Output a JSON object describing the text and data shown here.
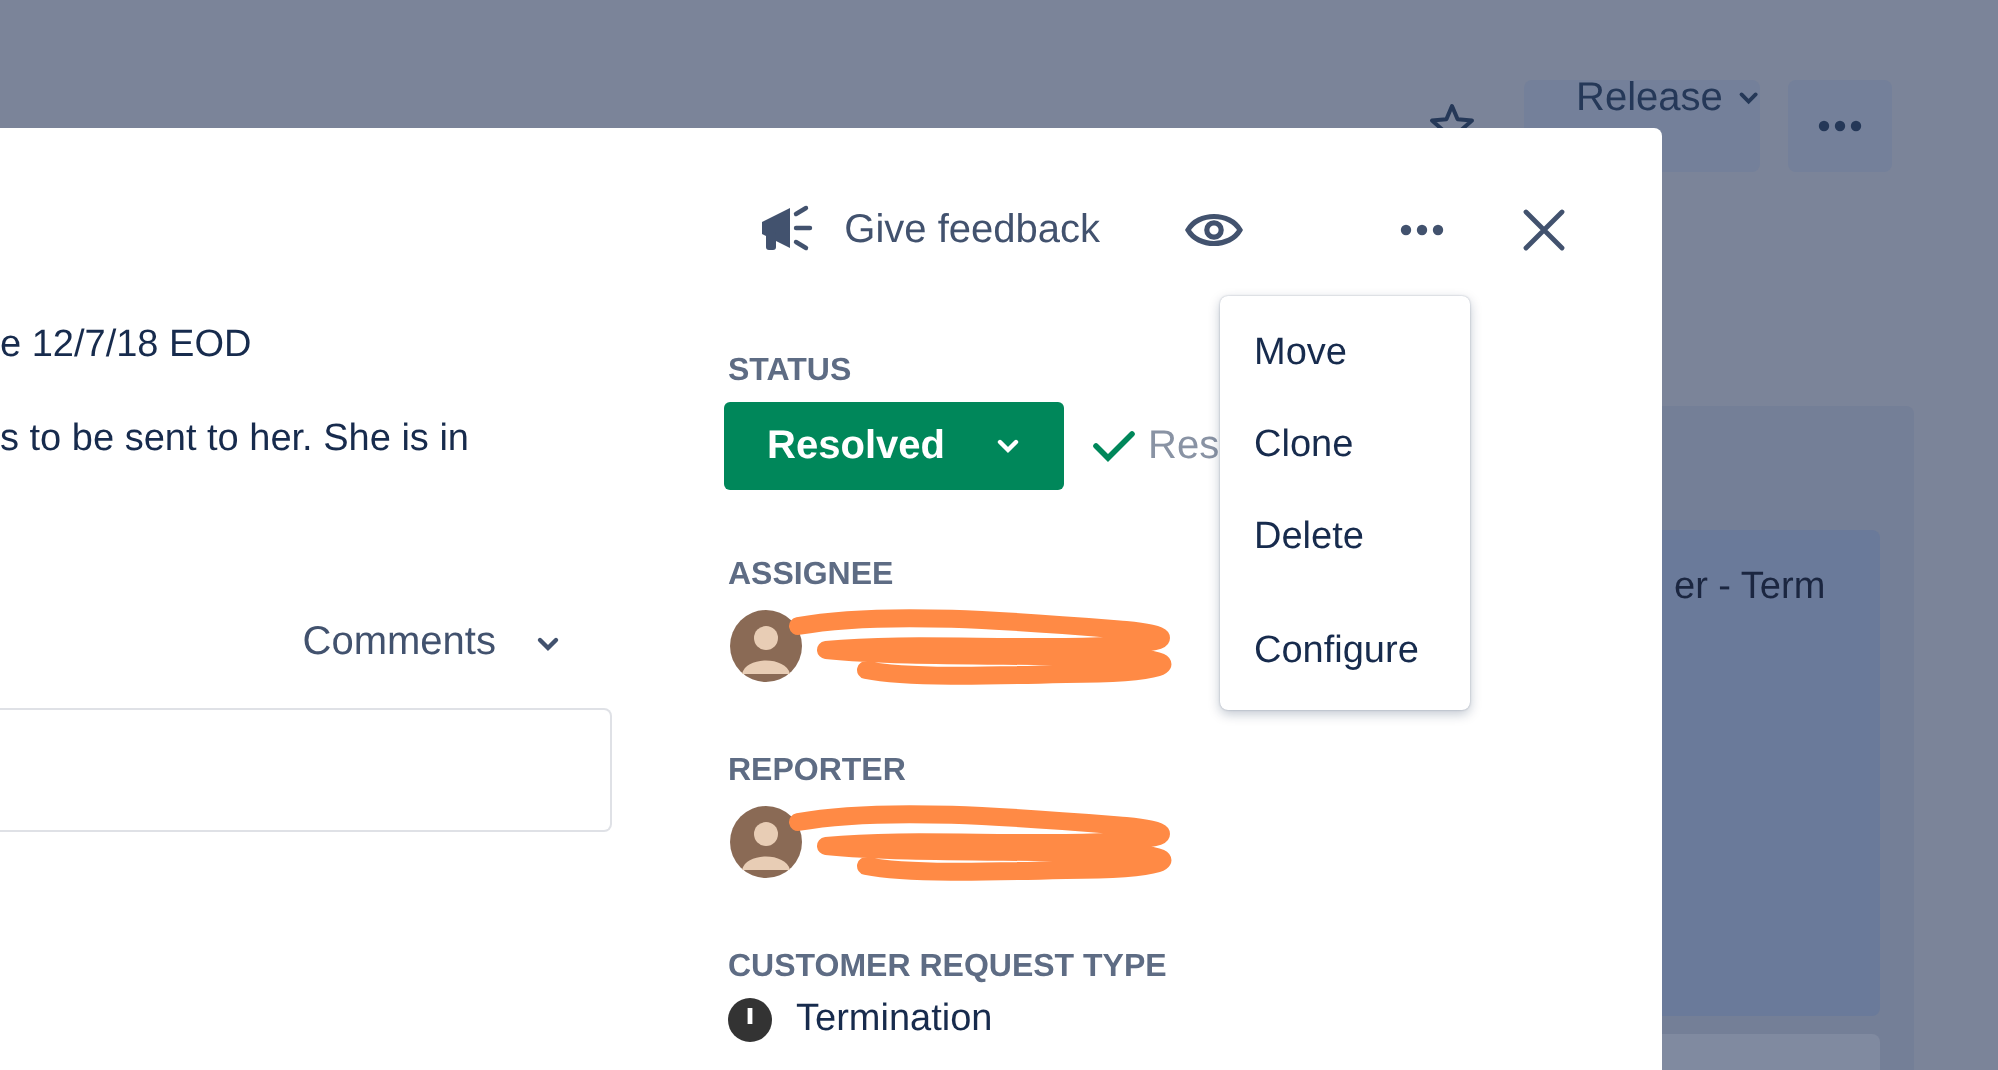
{
  "board": {
    "release_button": "Release",
    "card_text": "er - Term"
  },
  "header": {
    "feedback": "Give feedback"
  },
  "menu": {
    "groups": [
      [
        "Move",
        "Clone",
        "Delete"
      ],
      [
        "Configure"
      ]
    ]
  },
  "description": [
    "e 12/7/18 EOD",
    "s to be sent to her. She is in"
  ],
  "activity": {
    "filter": "Comments"
  },
  "fields": [
    {
      "kind": "status",
      "label": "STATUS",
      "value": "Resolved",
      "resolution": "Res"
    },
    {
      "kind": "person",
      "label": "ASSIGNEE"
    },
    {
      "kind": "person",
      "label": "REPORTER"
    },
    {
      "kind": "request_type",
      "label": "CUSTOMER REQUEST TYPE",
      "value": "Termination"
    }
  ]
}
